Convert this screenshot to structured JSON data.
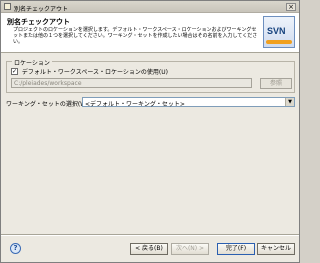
{
  "window": {
    "title": "別名チェックアウト",
    "close_label": "×"
  },
  "header": {
    "title": "別名チェックアウト",
    "description": "プロジェクトのロケーションを選択します。デフォルト・ワークスペース・ロケーションおよびワーキングセットまたは他の１つを選択してください。ワーキング・セットを作成したい場合はその名前を入力してください。",
    "logo_text": "SVN"
  },
  "location": {
    "group_title": "ロケーション",
    "checkbox_label": "デフォルト・ワークスペース・ロケーションの使用(U)",
    "checkbox_checked": true,
    "checkbox_mark": "✓",
    "path_value": "C:/pleiades/workspace",
    "browse_label": "参照"
  },
  "working_set": {
    "label": "ワーキング・セットの選択(W):",
    "selected": "<デフォルト・ワーキング・セット>",
    "arrow": "▼"
  },
  "footer": {
    "help_label": "?",
    "back_label": "< 戻る(B)",
    "next_label": "次へ(N) >",
    "finish_label": "完了(F)",
    "cancel_label": "キャンセル"
  },
  "colors": {
    "accent": "#2b5fb0",
    "logo": "#14417d"
  }
}
